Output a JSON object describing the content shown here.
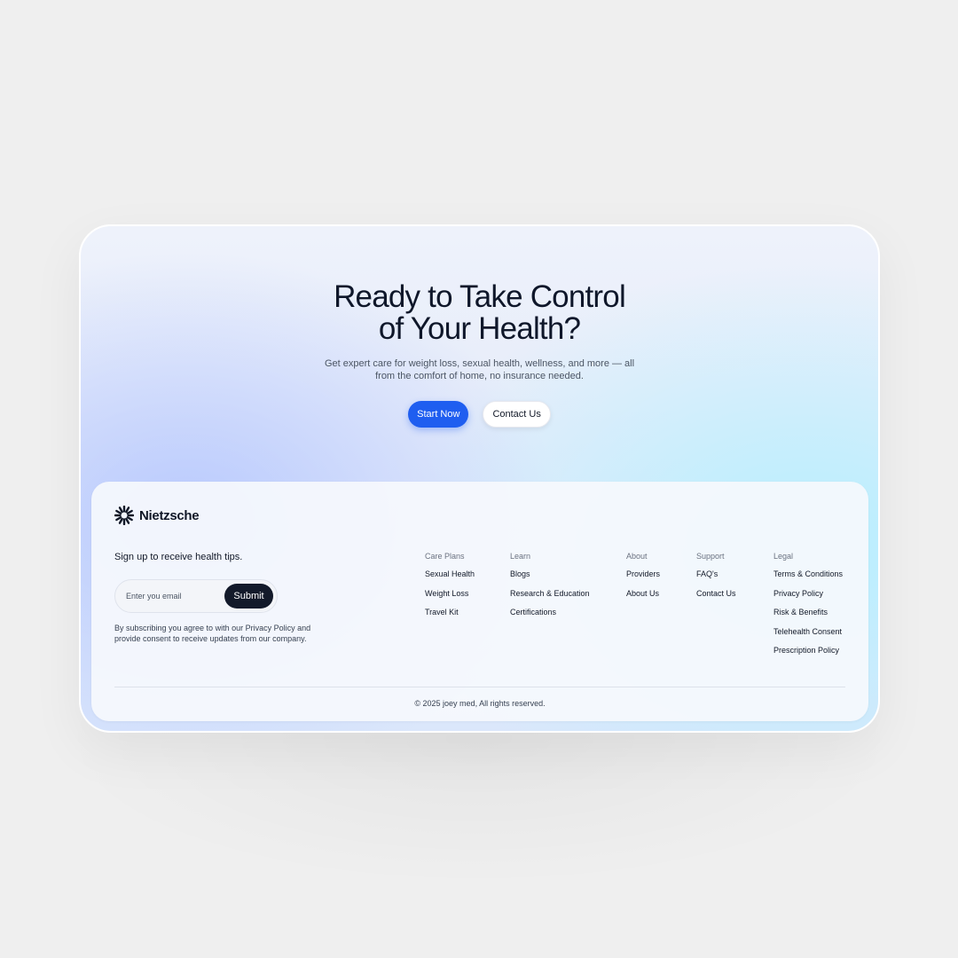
{
  "hero": {
    "title_line1": "Ready to Take Control",
    "title_line2": "of Your Health?",
    "subtitle": "Get expert care for weight loss, sexual health, wellness, and more — all from the comfort of home, no insurance needed.",
    "primary_cta": "Start Now",
    "secondary_cta": "Contact Us"
  },
  "footer": {
    "brand": "Nietzsche",
    "signup": {
      "title": "Sign up to receive health tips.",
      "placeholder": "Enter you email",
      "submit": "Submit",
      "consent": "By subscribing you agree to with our Privacy Policy and provide consent to receive updates from our company."
    },
    "columns": [
      {
        "title": "Care Plans",
        "links": [
          "Sexual Health",
          "Weight Loss",
          "Travel Kit"
        ]
      },
      {
        "title": "Learn",
        "links": [
          "Blogs",
          "Research & Education",
          "Certifications"
        ]
      },
      {
        "title": "About",
        "links": [
          "Providers",
          "About Us"
        ]
      },
      {
        "title": "Support",
        "links": [
          "FAQ's",
          "Contact Us"
        ]
      },
      {
        "title": "Legal",
        "links": [
          "Terms & Conditions",
          "Privacy Policy",
          "Risk & Benefits",
          "Telehealth Consent",
          "Prescription Policy"
        ]
      }
    ],
    "copyright": "© 2025 joey med, All rights reserved."
  },
  "colors": {
    "primary": "#1f5ef0",
    "dark": "#131a2a"
  }
}
